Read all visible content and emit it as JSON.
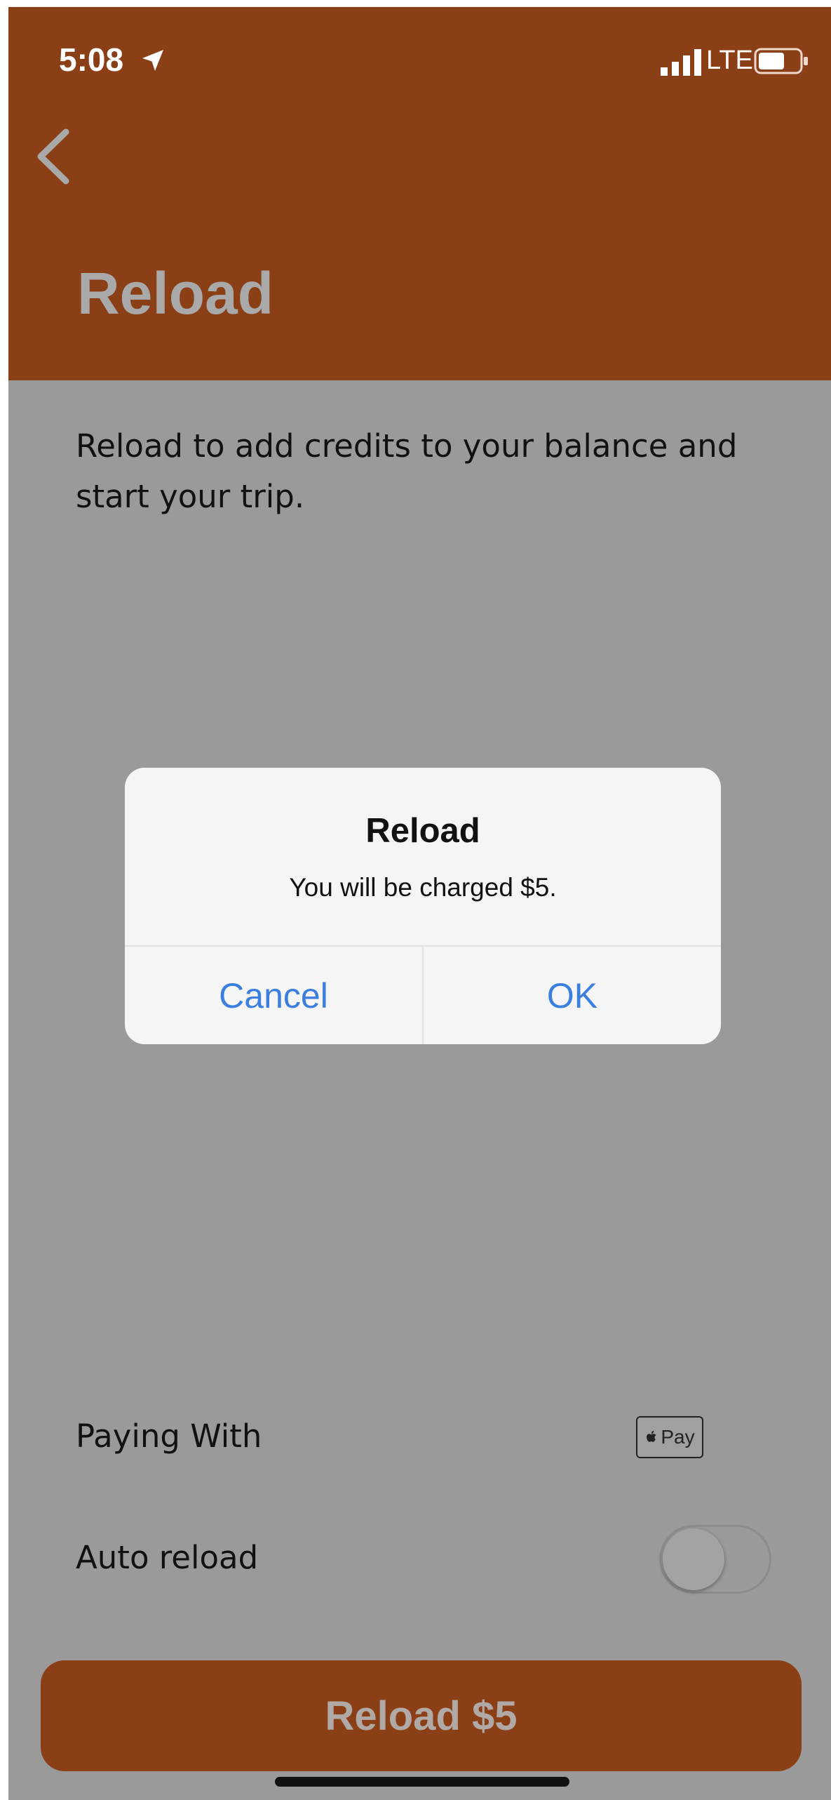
{
  "status_bar": {
    "time": "5:08",
    "network": "LTE"
  },
  "header": {
    "title": "Reload"
  },
  "intro_text": "Reload to add credits to your balance and start your trip.",
  "payment": {
    "label": "Paying With",
    "method_text": "Pay"
  },
  "auto_reload": {
    "label": "Auto reload",
    "enabled": false
  },
  "primary_button": {
    "label": "Reload $5"
  },
  "dialog": {
    "title": "Reload",
    "message": "You will be charged $5.",
    "cancel_label": "Cancel",
    "ok_label": "OK"
  },
  "colors": {
    "brand": "#8b3f16",
    "link_blue": "#3a7ee0",
    "overlay_gray": "#9a9a9a"
  }
}
